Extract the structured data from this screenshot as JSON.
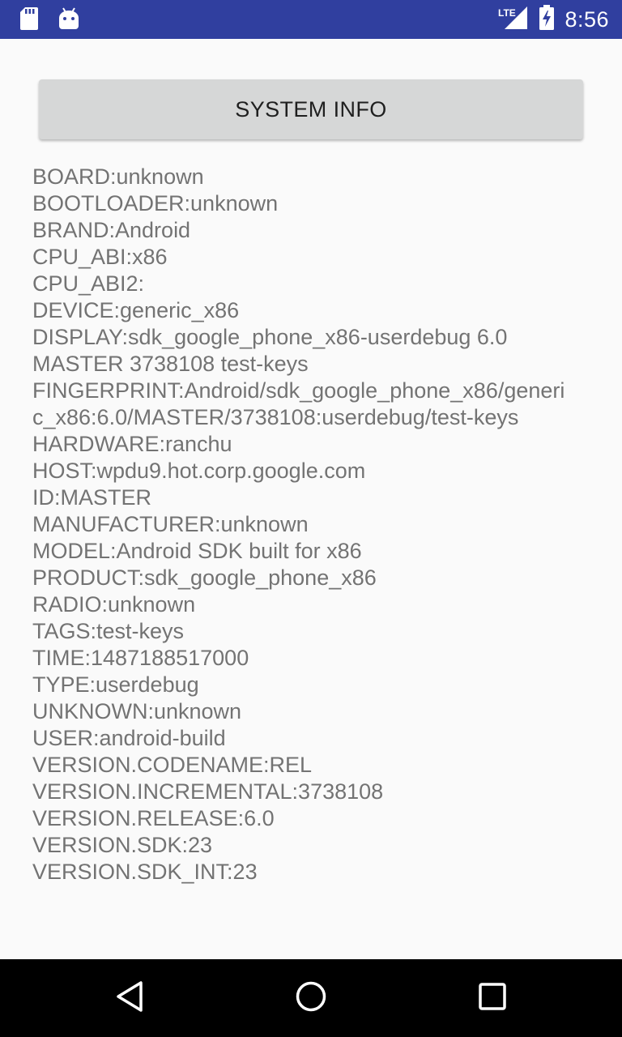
{
  "status_bar": {
    "clock": "8:56",
    "network_label": "LTE",
    "icons": [
      "sd-card-icon",
      "android-debug-icon",
      "lte-signal-icon",
      "battery-charging-icon"
    ],
    "background": "#303f9f"
  },
  "main": {
    "button_label": "SYSTEM INFO",
    "info_lines": [
      "BOARD:unknown",
      "BOOTLOADER:unknown",
      "BRAND:Android",
      "CPU_ABI:x86",
      "CPU_ABI2:",
      "DEVICE:generic_x86",
      "DISPLAY:sdk_google_phone_x86-userdebug 6.0 MASTER 3738108 test-keys",
      "FINGERPRINT:Android/sdk_google_phone_x86/generic_x86:6.0/MASTER/3738108:userdebug/test-keys",
      "HARDWARE:ranchu",
      "HOST:wpdu9.hot.corp.google.com",
      "ID:MASTER",
      "MANUFACTURER:unknown",
      "MODEL:Android SDK built for x86",
      "PRODUCT:sdk_google_phone_x86",
      "RADIO:unknown",
      "TAGS:test-keys",
      "TIME:1487188517000",
      "TYPE:userdebug",
      "UNKNOWN:unknown",
      "USER:android-build",
      "VERSION.CODENAME:REL",
      "VERSION.INCREMENTAL:3738108",
      "VERSION.RELEASE:6.0",
      "VERSION.SDK:23",
      "VERSION.SDK_INT:23"
    ]
  },
  "nav_bar": {
    "icons": [
      "back-icon",
      "home-icon",
      "recents-icon"
    ]
  }
}
